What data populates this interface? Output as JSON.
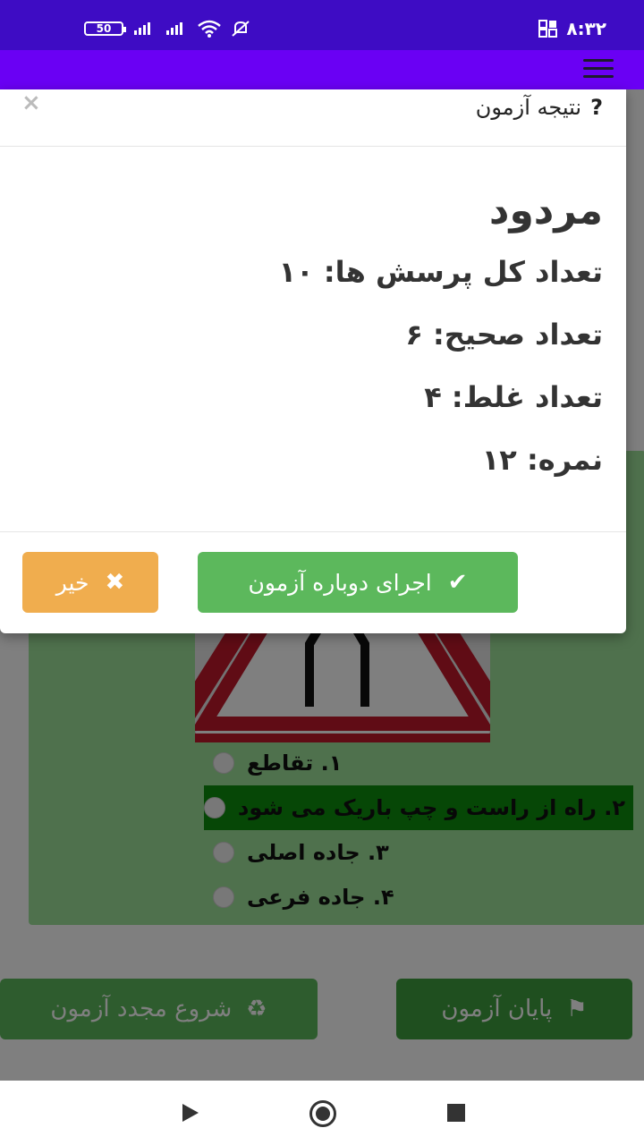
{
  "status_bar": {
    "time": "۸:۳۲",
    "battery": "50"
  },
  "page": {
    "options": [
      {
        "label": "۱. تقاطع",
        "selected": false
      },
      {
        "label": "۲. راه از راست و چپ باریک می شود",
        "selected": true
      },
      {
        "label": "۳. جاده اصلی",
        "selected": false
      },
      {
        "label": "۴. جاده فرعی",
        "selected": false
      }
    ],
    "restart_label": "شروع مجدد آزمون",
    "end_label": "پایان آزمون"
  },
  "modal": {
    "title": "نتیجه آزمون",
    "title_icon": "?",
    "close": "×",
    "verdict": "مردود",
    "total": "تعداد کل پرسش ها: ۱۰",
    "correct": "تعداد صحیح: ۶",
    "wrong": "تعداد غلط: ۴",
    "score": "نمره: ۱۲",
    "retry_label": "اجرای دوباره آزمون",
    "no_label": "خیر"
  },
  "colors": {
    "statusbar": "#3e0cc4",
    "toolbar": "#6a00f4",
    "success": "#5cb85c",
    "warning": "#f0ad4e"
  }
}
